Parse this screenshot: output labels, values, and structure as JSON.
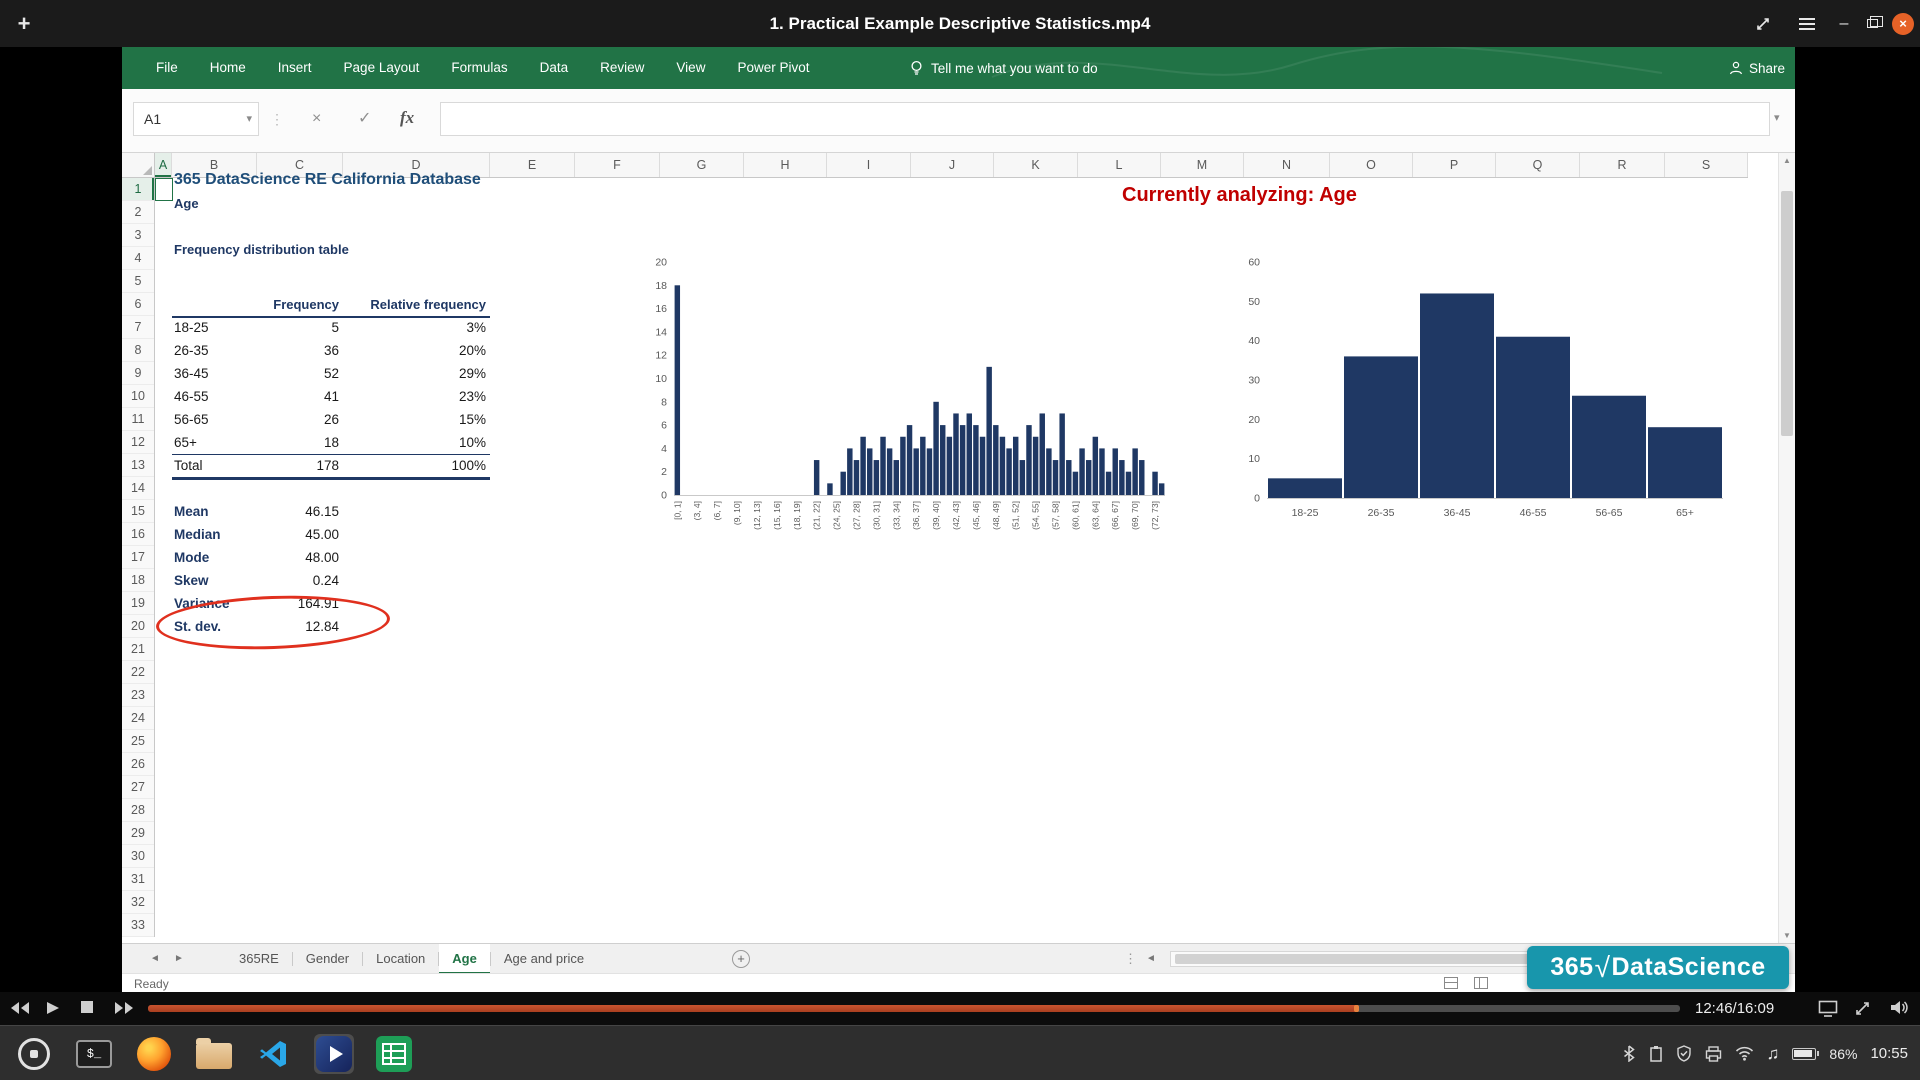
{
  "window": {
    "title": "1. Practical Example Descriptive Statistics.mp4"
  },
  "icons": {
    "plus": "+",
    "minimize": "–",
    "close": "×",
    "chevron_down": "▾",
    "dots_vertical": "⋮",
    "cancel": "×",
    "check": "✓",
    "left_arrow": "◄",
    "right_arrow": "►",
    "up_arrow": "▲",
    "down_arrow": "▼",
    "music_note": "♫",
    "new_sheet": "+"
  },
  "excel": {
    "ribbon": {
      "tabs": [
        "File",
        "Home",
        "Insert",
        "Page Layout",
        "Formulas",
        "Data",
        "Review",
        "View",
        "Power Pivot"
      ],
      "tell_me": "Tell me what you want to do",
      "share": "Share"
    },
    "formula_bar": {
      "name_box": "A1",
      "fx": "fx"
    },
    "grid": {
      "columns": [
        "A",
        "B",
        "C",
        "D",
        "E",
        "F",
        "G",
        "H",
        "I",
        "J",
        "K",
        "L",
        "M",
        "N",
        "O",
        "P",
        "Q",
        "R",
        "S"
      ],
      "rows": [
        "1",
        "2",
        "3",
        "4",
        "5",
        "6",
        "7",
        "8",
        "9",
        "10",
        "11",
        "12",
        "13",
        "14",
        "15",
        "16",
        "17",
        "18",
        "19",
        "20",
        "21",
        "22",
        "23",
        "24",
        "25",
        "26",
        "27",
        "28",
        "29",
        "30",
        "31",
        "32",
        "33"
      ]
    },
    "content": {
      "doc_title": "365 DataScience RE California Database",
      "doc_subtitle": "Age",
      "freq_title": "Frequency distribution table",
      "analyzing": "Currently analyzing: Age",
      "freq_headers": {
        "frequency": "Frequency",
        "relative": "Relative frequency"
      },
      "freq_rows": [
        [
          "18-25",
          "5",
          "3%"
        ],
        [
          "26-35",
          "36",
          "20%"
        ],
        [
          "36-45",
          "52",
          "29%"
        ],
        [
          "46-55",
          "41",
          "23%"
        ],
        [
          "56-65",
          "26",
          "15%"
        ],
        [
          "65+",
          "18",
          "10%"
        ]
      ],
      "total_row": [
        "Total",
        "178",
        "100%"
      ],
      "stats": [
        [
          "Mean",
          "46.15"
        ],
        [
          "Median",
          "45.00"
        ],
        [
          "Mode",
          "48.00"
        ],
        [
          "Skew",
          "0.24"
        ],
        [
          "Variance",
          "164.91"
        ],
        [
          "St. dev.",
          "12.84"
        ]
      ]
    },
    "sheet_tabs": {
      "tabs": [
        "365RE",
        "Gender",
        "Location",
        "Age",
        "Age and price"
      ],
      "active": "Age"
    },
    "status": {
      "ready": "Ready"
    }
  },
  "chart_data": [
    {
      "type": "bar",
      "ylim": [
        0,
        20
      ],
      "ytick_step": 2,
      "bar_color": "#1f3864",
      "label_every": 3,
      "x_tick_labels": [
        "[0, 1]",
        "(3, 4]",
        "(6, 7]",
        "(9, 10]",
        "(12, 13]",
        "(15, 16]",
        "(18, 19]",
        "(21, 22]",
        "(24, 25]",
        "(27, 28]",
        "(30, 31]",
        "(33, 34]",
        "(36, 37]",
        "(39, 40]",
        "(42, 43]",
        "(45, 46]",
        "(48, 49]",
        "(51, 52]",
        "(54, 55]",
        "(57, 58]",
        "(60, 61]",
        "(63, 64]",
        "(66, 67]",
        "(69, 70]",
        "(72, 73]"
      ],
      "values": [
        18,
        0,
        0,
        0,
        0,
        0,
        0,
        0,
        0,
        0,
        0,
        0,
        0,
        0,
        0,
        0,
        0,
        0,
        0,
        0,
        0,
        3,
        0,
        1,
        0,
        2,
        4,
        3,
        5,
        4,
        3,
        5,
        4,
        3,
        5,
        6,
        4,
        5,
        4,
        8,
        6,
        5,
        7,
        6,
        7,
        6,
        5,
        11,
        6,
        5,
        4,
        5,
        3,
        6,
        5,
        7,
        4,
        3,
        7,
        3,
        2,
        4,
        3,
        5,
        4,
        2,
        4,
        3,
        2,
        4,
        3,
        0,
        2,
        1
      ],
      "legend": false,
      "grid": false
    },
    {
      "type": "bar",
      "categories": [
        "18-25",
        "26-35",
        "36-45",
        "46-55",
        "56-65",
        "65+"
      ],
      "values": [
        5,
        36,
        52,
        41,
        26,
        18
      ],
      "ylim": [
        0,
        60
      ],
      "ytick_step": 10,
      "bar_color": "#1f3864",
      "legend": false,
      "grid": false
    }
  ],
  "logo": {
    "prefix": "365",
    "root": "√",
    "name": "DataScience"
  },
  "player": {
    "time": "12:46/16:09",
    "progress_fraction": 0.79
  },
  "taskbar": {
    "terminal_label": "$_",
    "battery": "86%",
    "clock": "10:55"
  }
}
